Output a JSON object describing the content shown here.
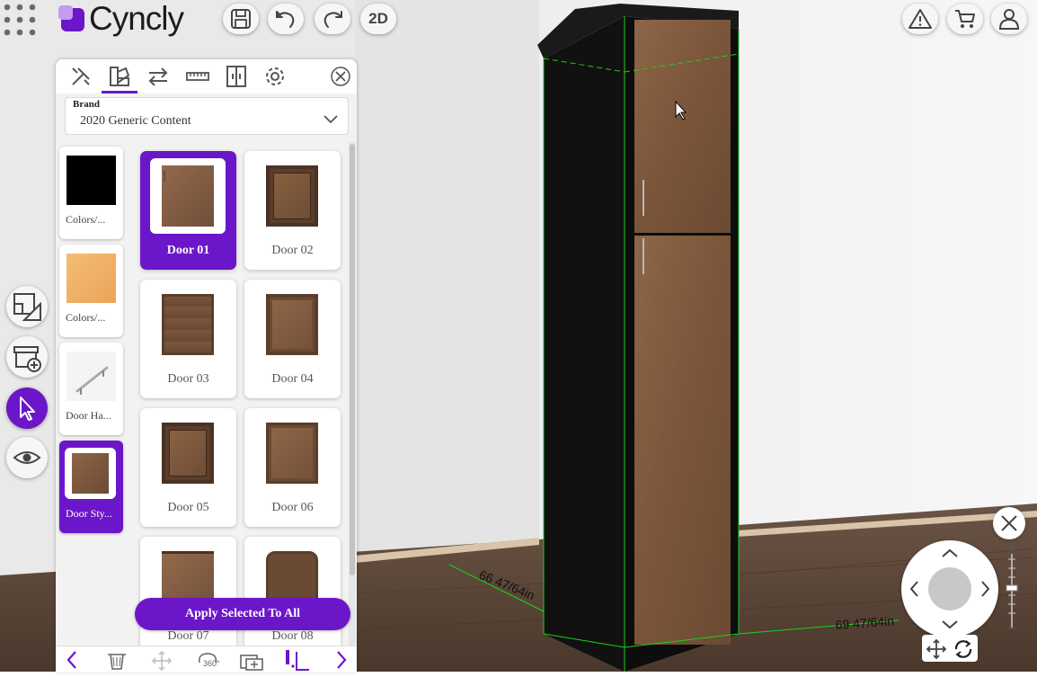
{
  "app": {
    "logo_text": "Cyncly",
    "view_toggle": "2D",
    "brand_color": "#6c16c9"
  },
  "toolbar_icons": [
    "save-icon",
    "undo-icon",
    "redo-icon"
  ],
  "right_icons": [
    "warning-icon",
    "cart-icon",
    "user-icon"
  ],
  "panel": {
    "tabs": [
      "tools-icon",
      "styles-icon",
      "swap-icon",
      "ruler-icon",
      "cabinet-icon",
      "settings-icon"
    ],
    "active_tab": 1,
    "brand_label": "Brand",
    "brand_value": "2020 Generic Content",
    "categories": [
      {
        "label": "Colors/...",
        "swatch": "#000000"
      },
      {
        "label": "Colors/...",
        "swatch": "#f0b46a"
      },
      {
        "label": "Door Ha...",
        "swatch": "handle"
      },
      {
        "label": "Door Sty...",
        "swatch": "#8a5a3c",
        "selected": true
      }
    ],
    "doors": [
      {
        "label": "Door 01",
        "selected": true
      },
      {
        "label": "Door 02"
      },
      {
        "label": "Door 03"
      },
      {
        "label": "Door 04"
      },
      {
        "label": "Door 05"
      },
      {
        "label": "Door 06"
      },
      {
        "label": "Door 07"
      },
      {
        "label": "Door 08"
      }
    ],
    "apply_label": "Apply Selected To All",
    "bottom_icons": [
      "prev-arrow-icon",
      "trash-icon",
      "move-icon",
      "rotate-360-icon",
      "duplicate-icon",
      "align-icon",
      "next-arrow-icon"
    ]
  },
  "left_tools": [
    "floorplan-icon",
    "add-cabinet-icon",
    "select-pointer-icon",
    "visibility-eye-icon"
  ],
  "dimensions": {
    "left": "66 47/64in",
    "right": "69 47/64in"
  }
}
